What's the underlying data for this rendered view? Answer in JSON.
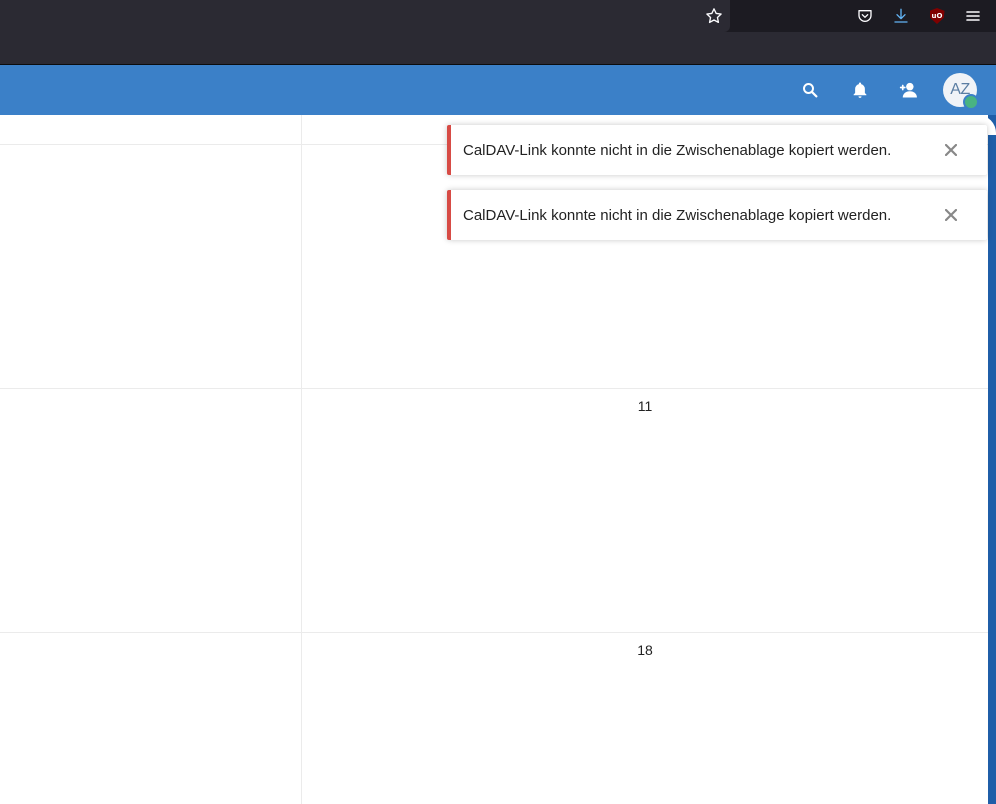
{
  "browser": {
    "icons": [
      "star-icon",
      "pocket-icon",
      "download-icon",
      "ublock-icon",
      "hamburger-menu-icon"
    ],
    "ublock_label": "uO"
  },
  "header": {
    "icons": [
      "search-icon",
      "notifications-icon",
      "contacts-icon"
    ],
    "avatar_initials": "AZ",
    "status": "online",
    "background_color": "#3b80c8"
  },
  "calendar": {
    "day_numbers": [
      "11",
      "18"
    ]
  },
  "toasts": [
    {
      "message": "CalDAV-Link konnte nicht in die Zwischenablage kopiert werden.",
      "type": "error"
    },
    {
      "message": "CalDAV-Link konnte nicht in die Zwischenablage kopiert werden.",
      "type": "error"
    }
  ],
  "colors": {
    "error_accent": "#d74b45",
    "status_online": "#49b382"
  }
}
